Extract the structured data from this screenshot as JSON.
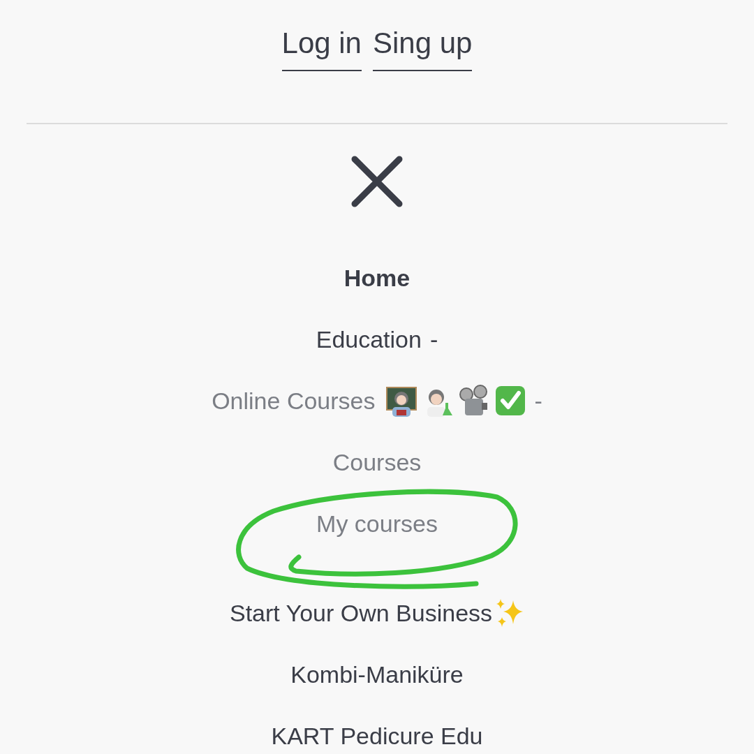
{
  "auth_links": [
    "Log in",
    "Sing up"
  ],
  "menu": [
    {
      "label": "Home",
      "selected": true,
      "kind": "plain"
    },
    {
      "label": "Education",
      "selected": false,
      "kind": "plain",
      "toggle": "-",
      "children": [
        {
          "label": "Online Courses",
          "selected": false,
          "kind": "emoji-row",
          "toggle": "-",
          "children": [
            {
              "label": "Courses",
              "selected": false,
              "kind": "plain"
            },
            {
              "label": "My courses",
              "selected": false,
              "kind": "plain"
            }
          ]
        }
      ]
    },
    {
      "label": "Start Your Own Business",
      "selected": false,
      "kind": "sparkle"
    },
    {
      "label": "Kombi-Maniküre",
      "selected": false,
      "kind": "plain"
    },
    {
      "label": "KART Pedicure Edu",
      "selected": false,
      "kind": "plain"
    }
  ]
}
